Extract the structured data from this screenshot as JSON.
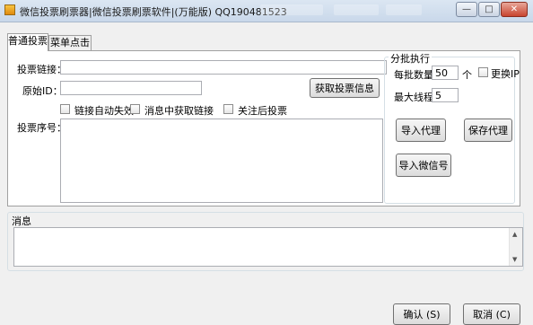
{
  "window": {
    "title": "微信投票刷票器|微信投票刷票软件|(万能版) QQ190481523",
    "minimize_label": "—",
    "maximize_label": "□",
    "close_label": "✕"
  },
  "tabs": [
    {
      "label": "普通投票",
      "active": true
    },
    {
      "label": "菜单点击",
      "active": false
    }
  ],
  "form": {
    "vote_link_label": "投票链接：",
    "vote_link_value": "",
    "original_id_label": "原始ID：",
    "original_id_value": "",
    "get_info_button": "获取投票信息",
    "checkbox_auto_expire": "链接自动失效",
    "checkbox_msg_get_link": "消息中获取链接",
    "checkbox_follow_vote": "关注后投票",
    "vote_seq_label": "投票序号：",
    "vote_seq_value": ""
  },
  "batch": {
    "group_title": "分批执行",
    "per_batch_label": "每批数量",
    "per_batch_value": "50",
    "per_batch_unit": "个",
    "change_ip_label": "更换IP",
    "max_threads_label": "最大线程",
    "max_threads_value": "5",
    "import_proxy_button": "导入代理",
    "save_proxy_button": "保存代理",
    "import_wechat_button": "导入微信号"
  },
  "messages": {
    "group_title": "消息",
    "content": ""
  },
  "footer": {
    "confirm_button": "确认 (S)",
    "cancel_button": "取消 (C)"
  }
}
